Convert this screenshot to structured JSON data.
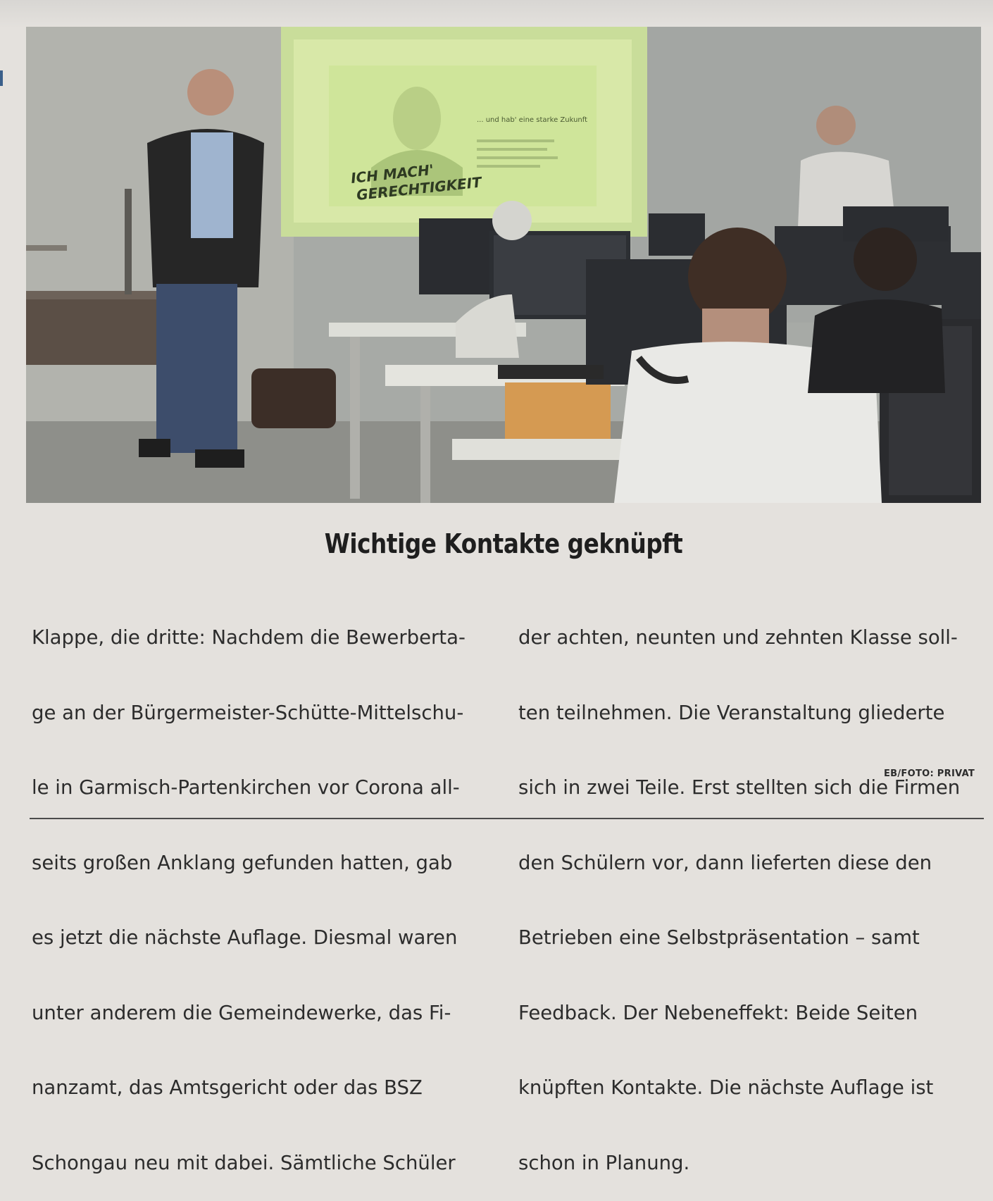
{
  "article": {
    "headline": "Wichtige Kontakte geknüpft",
    "body_left": [
      "Klappe, die dritte: Nachdem die Bewerberta-",
      "ge an der Bürgermeister-Schütte-Mittelschu-",
      "le in Garmisch-Partenkirchen vor Corona all-",
      "seits großen Anklang gefunden hatten, gab",
      "es jetzt die nächste Auflage. Diesmal waren",
      "unter anderem die Gemeindewerke, das Fi-",
      "nanzamt, das Amtsgericht oder das BSZ",
      "Schongau neu mit dabei. Sämtliche Schüler"
    ],
    "body_right": [
      "der achten, neunten und zehnten Klasse soll-",
      "ten teilnehmen. Die Veranstaltung gliederte",
      "sich in zwei Teile. Erst stellten sich die Firmen",
      "den Schülern vor, dann lieferten diese den",
      "Betrieben eine Selbstpräsentation – samt",
      "Feedback. Der Nebeneffekt: Beide Seiten",
      "knüpften Kontakte. Die nächste Auflage ist",
      "schon in Planung."
    ],
    "credit": "EB/FOTO: PRIVAT"
  },
  "photo": {
    "screen_slogan_line1": "ICH MACH'",
    "screen_slogan_line2": "GERECHTIGKEIT",
    "screen_tagline": "... und hab' eine starke Zukunft"
  }
}
